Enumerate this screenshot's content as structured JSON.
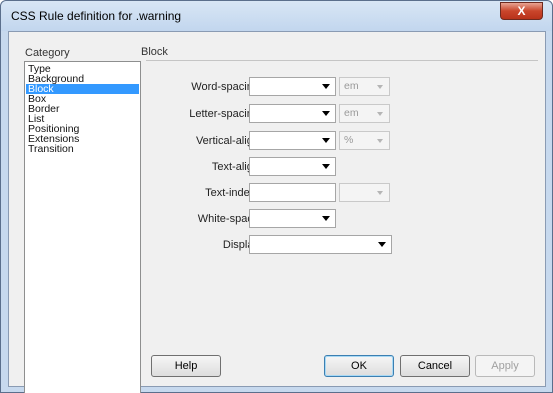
{
  "window": {
    "title": "CSS Rule definition for .warning",
    "close_label": "X"
  },
  "category": {
    "heading": "Category",
    "items": [
      "Type",
      "Background",
      "Block",
      "Box",
      "Border",
      "List",
      "Positioning",
      "Extensions",
      "Transition"
    ],
    "selected": "Block"
  },
  "panel": {
    "heading": "Block",
    "fields": {
      "word_spacing": {
        "label": "Word-spacing:",
        "value": "",
        "unit": "em"
      },
      "letter_spacing": {
        "label": "Letter-spacing:",
        "value": "",
        "unit": "em"
      },
      "vertical_align": {
        "label": "Vertical-align:",
        "value": "",
        "unit": "%"
      },
      "text_align": {
        "label": "Text-align:",
        "value": ""
      },
      "text_indent": {
        "label": "Text-indent:",
        "value": "",
        "unit": ""
      },
      "white_space": {
        "label": "White-space:",
        "value": ""
      },
      "display": {
        "label": "Display:",
        "value": ""
      }
    }
  },
  "buttons": {
    "help": "Help",
    "ok": "OK",
    "cancel": "Cancel",
    "apply": "Apply"
  },
  "colors": {
    "selection": "#3399ff",
    "title_bar": "#c7d9ee",
    "close_button": "#c9452b"
  }
}
